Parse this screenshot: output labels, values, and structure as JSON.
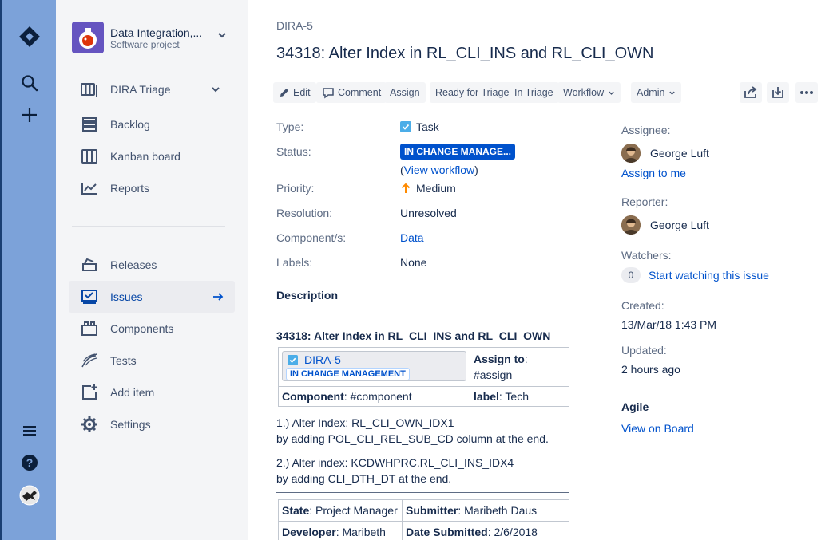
{
  "global_nav": {
    "icons": [
      "jira-logo-icon",
      "search-icon",
      "create-icon",
      "menu-icon",
      "help-icon",
      "profile-avatar"
    ]
  },
  "sidebar": {
    "project_name": "Data Integration,...",
    "project_type": "Software project",
    "board": "DIRA Triage",
    "items": [
      {
        "label": "Backlog",
        "icon": "backlog-icon"
      },
      {
        "label": "Kanban board",
        "icon": "board-icon"
      },
      {
        "label": "Reports",
        "icon": "reports-icon"
      },
      {
        "label": "Releases",
        "icon": "releases-icon"
      },
      {
        "label": "Issues",
        "icon": "issues-icon"
      },
      {
        "label": "Components",
        "icon": "components-icon"
      },
      {
        "label": "Tests",
        "icon": "tests-icon"
      },
      {
        "label": "Add item",
        "icon": "add-item-icon"
      },
      {
        "label": "Settings",
        "icon": "settings-icon"
      }
    ]
  },
  "issue": {
    "key": "DIRA-5",
    "title": "34318: Alter Index in RL_CLI_INS and RL_CLI_OWN"
  },
  "toolbar": {
    "edit": "Edit",
    "comment": "Comment",
    "assign": "Assign",
    "ready_for_triage": "Ready for Triage",
    "in_triage": "In Triage",
    "workflow": "Workflow",
    "admin": "Admin"
  },
  "details": {
    "type_label": "Type:",
    "type_value": "Task",
    "status_label": "Status:",
    "status_value": "IN CHANGE MANAGE...",
    "view_workflow_open": "(",
    "view_workflow": "View workflow",
    "view_workflow_close": ")",
    "priority_label": "Priority:",
    "priority_value": "Medium",
    "resolution_label": "Resolution:",
    "resolution_value": "Unresolved",
    "components_label": "Component/s:",
    "components_value": "Data",
    "labels_label": "Labels:",
    "labels_value": "None"
  },
  "people": {
    "assignee_label": "Assignee:",
    "assignee": "George Luft",
    "assign_to_me": "Assign to me",
    "reporter_label": "Reporter:",
    "reporter": "George Luft",
    "watchers_label": "Watchers:",
    "watch_count": "0",
    "start_watching": "Start watching this issue"
  },
  "dates": {
    "created_label": "Created:",
    "created": "13/Mar/18 1:43 PM",
    "updated_label": "Updated:",
    "updated": "2 hours ago"
  },
  "agile": {
    "heading": "Agile",
    "view_on_board": "View on Board"
  },
  "description": {
    "heading": "Description",
    "subtitle": "34318: Alter Index in RL_CLI_INS and RL_CLI_OWN",
    "card_key": "DIRA-5",
    "card_status": "IN CHANGE MANAGEMENT",
    "assign_to_label": "Assign to",
    "assign_to_colon": ":",
    "assign_to_value": "#assign",
    "component_label": "Component",
    "component_value": ": #component",
    "label_label": "label",
    "label_value": ": Tech",
    "step1_line1": "1.) Alter Index: RL_CLI_OWN_IDX1",
    "step1_line2": "by adding POL_CLI_REL_SUB_CD column at the end.",
    "step2_line1": "2.) Alter index: KCDWHPRC.RL_CLI_INS_IDX4",
    "step2_line2": "by adding CLI_DTH_DT at the end.",
    "state_label": "State",
    "state_value": ": Project Manager",
    "submitter_label": "Submitter",
    "submitter_value": ": Maribeth Daus",
    "developer_label": "Developer",
    "developer_value": ": Maribeth",
    "date_submitted_label": "Date Submitted",
    "date_submitted_value": ": 2/6/2018"
  },
  "colors": {
    "global_nav": "#7ca2d9",
    "sidebar": "#f4f5f7",
    "link": "#0052cc",
    "status_lozenge": "#0052cc",
    "priority_medium": "#ff8b00"
  }
}
